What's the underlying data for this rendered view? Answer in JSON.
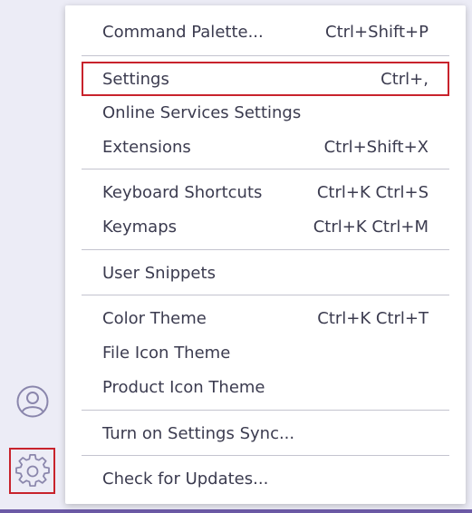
{
  "menu": {
    "items": [
      {
        "label": "Command Palette...",
        "shortcut": "Ctrl+Shift+P"
      },
      {
        "label": "Settings",
        "shortcut": "Ctrl+,"
      },
      {
        "label": "Online Services Settings",
        "shortcut": ""
      },
      {
        "label": "Extensions",
        "shortcut": "Ctrl+Shift+X"
      },
      {
        "label": "Keyboard Shortcuts",
        "shortcut": "Ctrl+K Ctrl+S"
      },
      {
        "label": "Keymaps",
        "shortcut": "Ctrl+K Ctrl+M"
      },
      {
        "label": "User Snippets",
        "shortcut": ""
      },
      {
        "label": "Color Theme",
        "shortcut": "Ctrl+K Ctrl+T"
      },
      {
        "label": "File Icon Theme",
        "shortcut": ""
      },
      {
        "label": "Product Icon Theme",
        "shortcut": ""
      },
      {
        "label": "Turn on Settings Sync...",
        "shortcut": ""
      },
      {
        "label": "Check for Updates...",
        "shortcut": ""
      }
    ]
  },
  "activity_bar": {
    "icons": [
      "account-icon",
      "gear-icon"
    ]
  },
  "colors": {
    "highlight_border": "#c8232c",
    "icon_color": "#8a86ac",
    "accent_strip": "#6c5aa6"
  }
}
